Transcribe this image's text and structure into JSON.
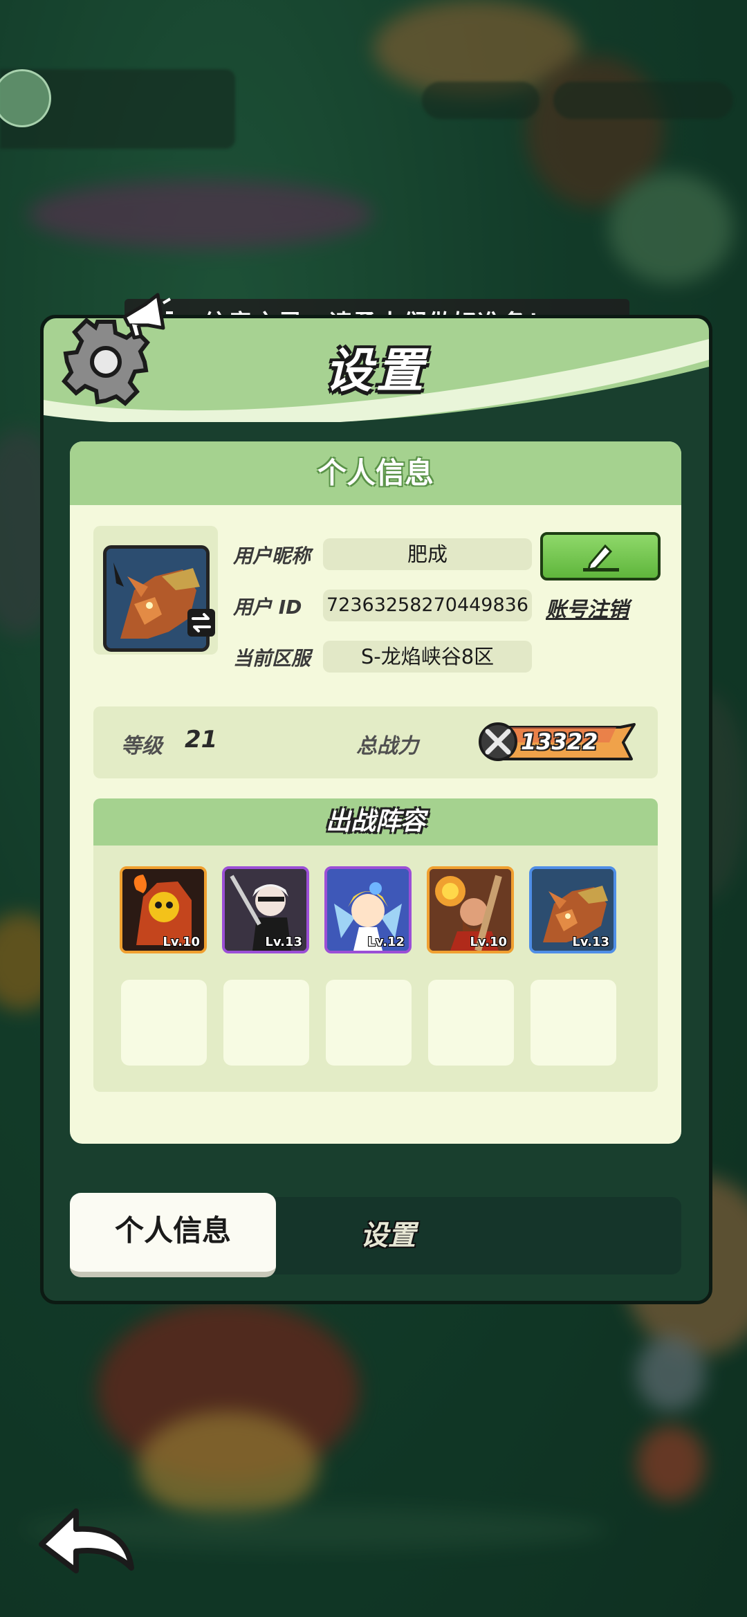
{
  "announcement": "...纹章之灵，请勇士们做好准备！",
  "panel_title": "设置",
  "card_title": "个人信息",
  "profile": {
    "nickname_label": "用户昵称",
    "nickname": "肥成",
    "id_label": "用户  ID",
    "id": "7236325827044983­6",
    "cancel_account": "账号注销",
    "server_label": "当前区服",
    "server": "S-龙焰峡谷8区"
  },
  "stats": {
    "level_label": "等级",
    "level": "21",
    "power_label": "总战力",
    "power": "13322"
  },
  "team": {
    "title": "出战阵容",
    "heroes": [
      {
        "lv": "Lv.10",
        "rarity": "orange"
      },
      {
        "lv": "Lv.13",
        "rarity": "purple"
      },
      {
        "lv": "Lv.12",
        "rarity": "purple"
      },
      {
        "lv": "Lv.10",
        "rarity": "orange"
      },
      {
        "lv": "Lv.13",
        "rarity": "blue"
      }
    ]
  },
  "tabs": {
    "personal": "个人信息",
    "settings": "设置"
  },
  "icons": [
    "gear-icon",
    "megaphone-icon",
    "edit-icon",
    "swap-icon",
    "swords-icon",
    "back-arrow-icon"
  ],
  "colors": {
    "panel_green": "#a7d292",
    "card_bg": "#f4f9dc",
    "edit_button": "#6cc648",
    "power_bar": "#f0a24a"
  }
}
